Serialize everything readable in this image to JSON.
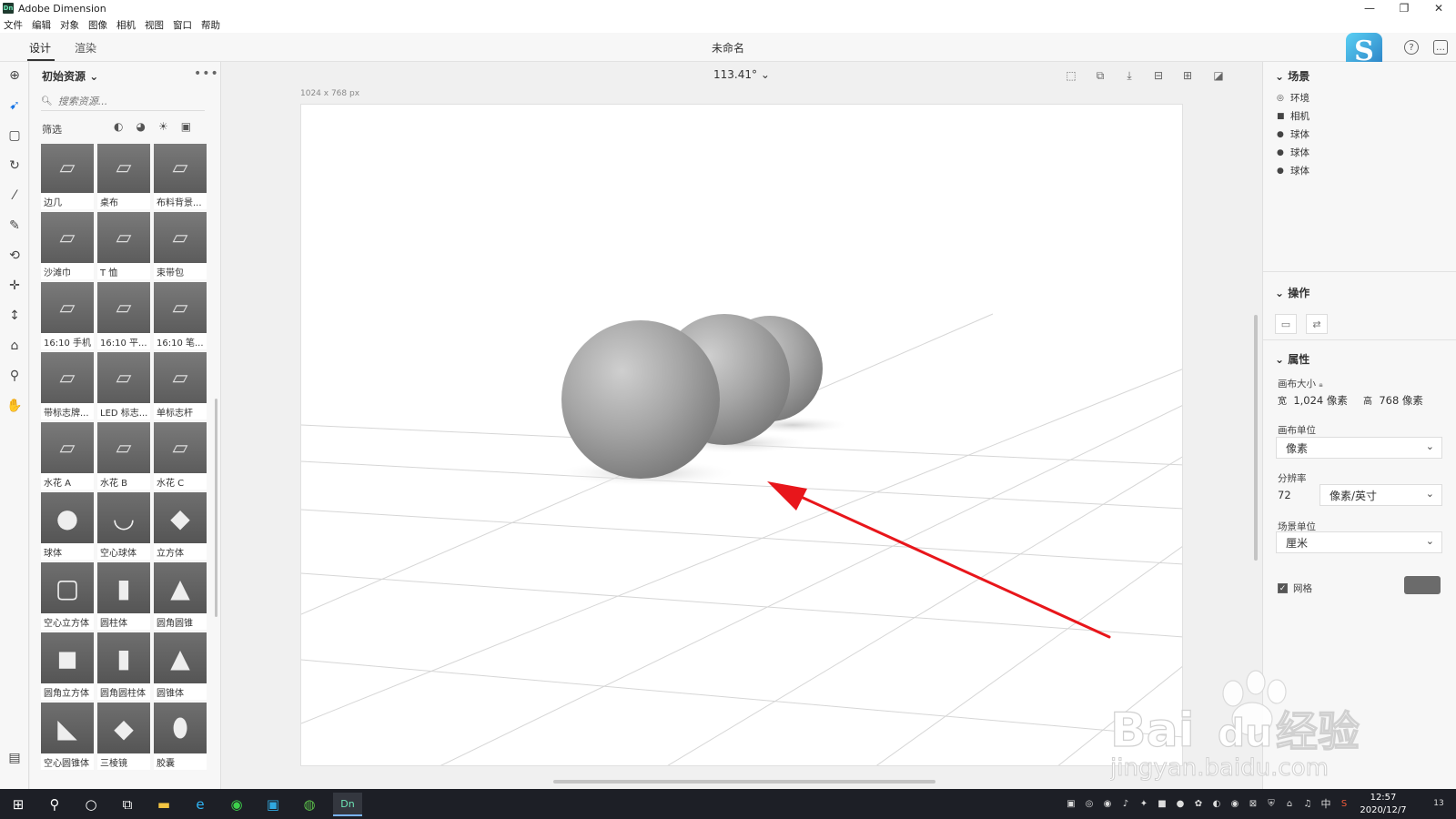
{
  "window": {
    "title": "Adobe Dimension",
    "app_icon_label": "Dn",
    "controls": [
      "—",
      "❐",
      "✕"
    ]
  },
  "menu": [
    "文件",
    "编辑",
    "对象",
    "图像",
    "相机",
    "视图",
    "窗口",
    "帮助"
  ],
  "tabs": [
    {
      "label": "设计",
      "active": true
    },
    {
      "label": "渲染",
      "active": false
    }
  ],
  "document_title": "未命名",
  "avatar_letter": "S",
  "top_icons": {
    "help": "?",
    "chat": "…"
  },
  "assets": {
    "title": "初始资源",
    "search_placeholder": "搜索资源...",
    "filter_label": "筛选",
    "items": [
      "边几",
      "桌布",
      "布料背景...",
      "沙滩巾",
      "T 恤",
      "束带包",
      "16:10 手机",
      "16:10 平...",
      "16:10 笔...",
      "带标志牌...",
      "LED 标志...",
      "单标志杆",
      "水花 A",
      "水花 B",
      "水花 C",
      "球体",
      "空心球体",
      "立方体",
      "空心立方体",
      "圆柱体",
      "圆角圆锥",
      "圆角立方体",
      "圆角圆柱体",
      "圆锥体",
      "空心圆锥体",
      "三棱镜",
      "胶囊"
    ]
  },
  "viewport": {
    "zoom": "113.41°",
    "canvas_size_label": "1024 x 768 px"
  },
  "scene": {
    "title": "场景",
    "items": [
      {
        "icon": "environment-icon",
        "glyph": "◎",
        "label": "环境"
      },
      {
        "icon": "camera-icon",
        "glyph": "■",
        "label": "相机"
      },
      {
        "icon": "sphere-icon",
        "glyph": "●",
        "label": "球体"
      },
      {
        "icon": "sphere-icon",
        "glyph": "●",
        "label": "球体"
      },
      {
        "icon": "sphere-icon",
        "glyph": "●",
        "label": "球体"
      }
    ]
  },
  "actions": {
    "title": "操作"
  },
  "properties": {
    "title": "属性",
    "canvas_size_label": "画布大小",
    "width_label": "宽",
    "width_value": "1,024 像素",
    "height_label": "高",
    "height_value": "768 像素",
    "canvas_unit_label": "画布单位",
    "canvas_unit_value": "像素",
    "resolution_label": "分辨率",
    "resolution_value": "72",
    "resolution_unit_value": "像素/英寸",
    "scene_unit_label": "场景单位",
    "scene_unit_value": "厘米",
    "grid_label": "网格",
    "grid_checked": true
  },
  "taskbar": {
    "time": "12:57",
    "date": "2020/12/7",
    "ime": "中",
    "notif_count": "13",
    "dn_label": "Dn"
  },
  "watermark": {
    "brand": "Bai",
    "brand2": "du",
    "cn": "经验",
    "url": "jingyan.baidu.com"
  },
  "colors": {
    "accent": "#1473e6",
    "arrow": "#e8161b",
    "taskbar": "#1d1f26"
  }
}
